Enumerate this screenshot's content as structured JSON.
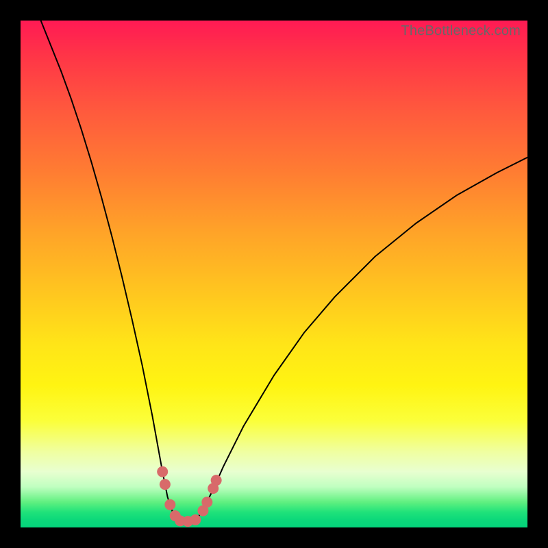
{
  "watermark": "TheBottleneck.com",
  "colors": {
    "background": "#000000",
    "gradient_top": "#ff1a54",
    "gradient_bottom": "#04d47b",
    "curve": "#000000",
    "marker": "#d86a6a"
  },
  "chart_data": {
    "type": "line",
    "title": "",
    "xlabel": "",
    "ylabel": "",
    "xlim": [
      0,
      100
    ],
    "ylim": [
      0,
      100
    ],
    "grid": false,
    "legend": null,
    "series": [
      {
        "name": "bottleneck-curve",
        "x": [
          4.0,
          6.0,
          8.0,
          10.0,
          12.0,
          14.0,
          16.0,
          18.0,
          20.0,
          22.0,
          24.0,
          26.0,
          27.0,
          28.0,
          29.0,
          30.0,
          31.0,
          32.0,
          33.0,
          34.0,
          35.0,
          36.0,
          38.0,
          40.0,
          44.0,
          50.0,
          56.0,
          62.0,
          70.0,
          78.0,
          86.0,
          94.0,
          100.0
        ],
        "y": [
          100.0,
          95.0,
          90.0,
          84.5,
          78.5,
          72.0,
          65.0,
          57.5,
          49.5,
          41.0,
          32.0,
          22.0,
          16.5,
          11.0,
          6.0,
          3.0,
          1.5,
          1.0,
          1.0,
          1.2,
          2.0,
          3.5,
          7.5,
          12.0,
          20.0,
          30.0,
          38.5,
          45.5,
          53.5,
          60.0,
          65.5,
          70.0,
          73.0
        ]
      }
    ],
    "markers": [
      {
        "x": 28.0,
        "y": 11.0
      },
      {
        "x": 28.5,
        "y": 8.5
      },
      {
        "x": 29.5,
        "y": 4.5
      },
      {
        "x": 30.5,
        "y": 2.3
      },
      {
        "x": 31.5,
        "y": 1.3
      },
      {
        "x": 33.0,
        "y": 1.2
      },
      {
        "x": 34.5,
        "y": 1.5
      },
      {
        "x": 36.0,
        "y": 3.3
      },
      {
        "x": 36.8,
        "y": 5.0
      },
      {
        "x": 38.0,
        "y": 7.7
      },
      {
        "x": 38.6,
        "y": 9.3
      }
    ],
    "marker_radius_px": 8
  }
}
